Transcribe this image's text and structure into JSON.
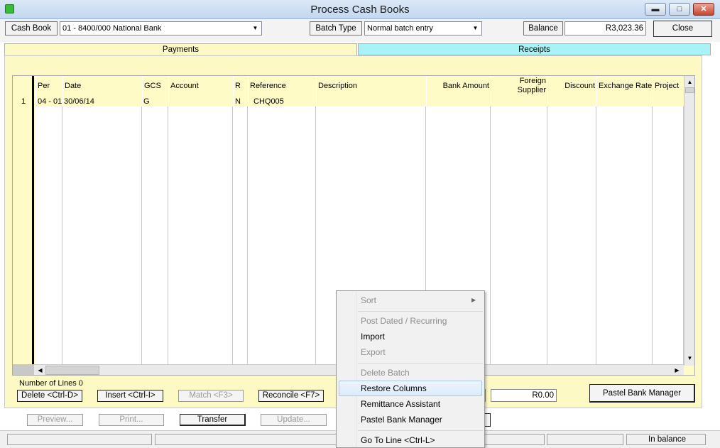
{
  "window": {
    "title": "Process Cash Books",
    "minimize": "▬",
    "maximize": "□",
    "close": "✕"
  },
  "toolbar": {
    "cashbook_btn": "Cash Book",
    "cashbook_value": "01 -  8400/000 National Bank",
    "batchtype_btn": "Batch Type",
    "batchtype_value": "Normal batch entry",
    "balance_btn": "Balance",
    "balance_value": "R3,023.36",
    "close_btn": "Close"
  },
  "tabs": {
    "payments": "Payments",
    "receipts": "Receipts",
    "payments_color": "#fdf9c4",
    "receipts_color": "#a9f3f6"
  },
  "grid": {
    "headers": {
      "per": "Per",
      "date": "Date",
      "gcs": "GCS",
      "account": "Account",
      "r": "R",
      "reference": "Reference",
      "description": "Description",
      "bank_amount": "Bank Amount",
      "foreign_supplier_1": "Foreign",
      "foreign_supplier_2": "Supplier",
      "discount": "Discount",
      "exchange_rate": "Exchange Rate",
      "project": "Project"
    },
    "rows": [
      {
        "line": "1",
        "per": "04 - 01",
        "date": "30/06/14",
        "gcs": "G",
        "account": "",
        "r": "N",
        "reference": "CHQ005",
        "description": "",
        "bank_amount": ""
      }
    ]
  },
  "footer": {
    "number_of_lines": "Number of Lines 0",
    "delete_btn": "Delete <Ctrl-D>",
    "insert_btn": "Insert <Ctrl-I>",
    "match_btn": "Match <F3>",
    "reconcile_btn": "Reconcile <F7>",
    "total_value": "R0.00",
    "pastel_bank_manager_btn": "Pastel Bank Manager",
    "preview_btn": "Preview...",
    "print_btn": "Print...",
    "transfer_btn": "Transfer",
    "update_btn": "Update..."
  },
  "context_menu": {
    "sort": "Sort",
    "post_dated": "Post Dated / Recurring",
    "import": "Import",
    "export": "Export",
    "delete_batch": "Delete Batch",
    "restore_columns": "Restore Columns",
    "remittance_assistant": "Remittance Assistant",
    "pastel_bank_manager": "Pastel Bank Manager",
    "go_to_line": "Go To Line <Ctrl-L>"
  },
  "status": {
    "in_balance": "In balance"
  }
}
